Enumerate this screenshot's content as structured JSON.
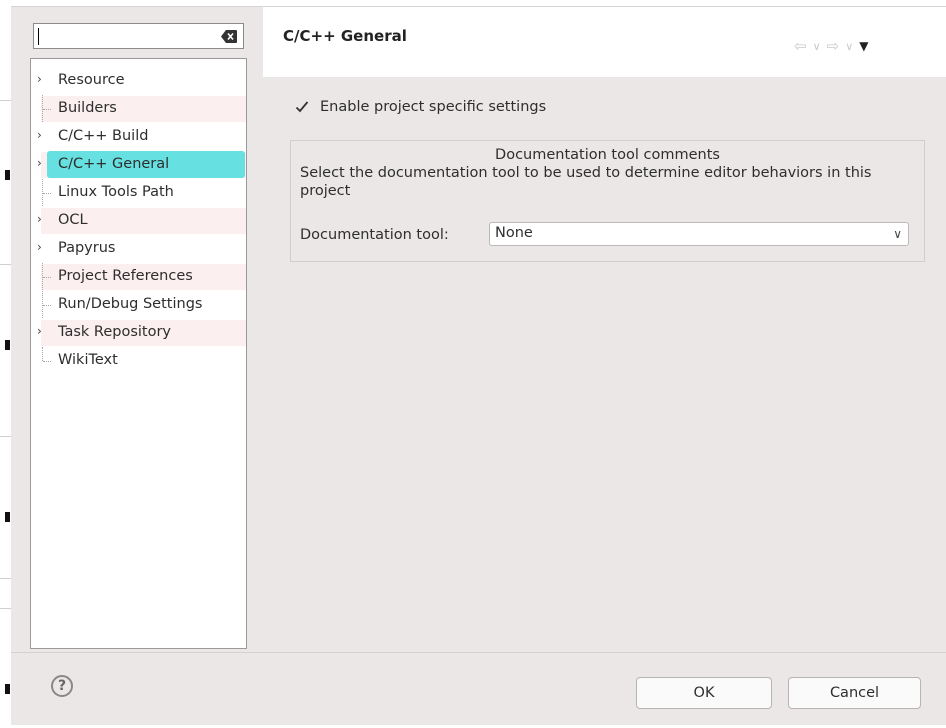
{
  "filter": {
    "value": "",
    "placeholder": ""
  },
  "tree": {
    "items": [
      {
        "label": "Resource",
        "expandable": true
      },
      {
        "label": "Builders",
        "expandable": false
      },
      {
        "label": "C/C++ Build",
        "expandable": true
      },
      {
        "label": "C/C++ General",
        "expandable": true,
        "selected": true
      },
      {
        "label": "Linux Tools Path",
        "expandable": false
      },
      {
        "label": "OCL",
        "expandable": true
      },
      {
        "label": "Papyrus",
        "expandable": true
      },
      {
        "label": "Project References",
        "expandable": false
      },
      {
        "label": "Run/Debug Settings",
        "expandable": false
      },
      {
        "label": "Task Repository",
        "expandable": true
      },
      {
        "label": "WikiText",
        "expandable": false
      }
    ]
  },
  "page": {
    "title": "C/C++ General",
    "enable_label": "Enable project specific settings",
    "enable_checked": true,
    "group_title": "Documentation tool comments",
    "group_desc": "Select the documentation tool to be used to determine editor behaviors in this project",
    "doc_tool_label": "Documentation tool:",
    "doc_tool_value": "None"
  },
  "footer": {
    "ok_label": "OK",
    "cancel_label": "Cancel",
    "help_symbol": "?"
  },
  "colors": {
    "selection": "#66e0e0",
    "dialog_bg": "#ece7e7"
  }
}
